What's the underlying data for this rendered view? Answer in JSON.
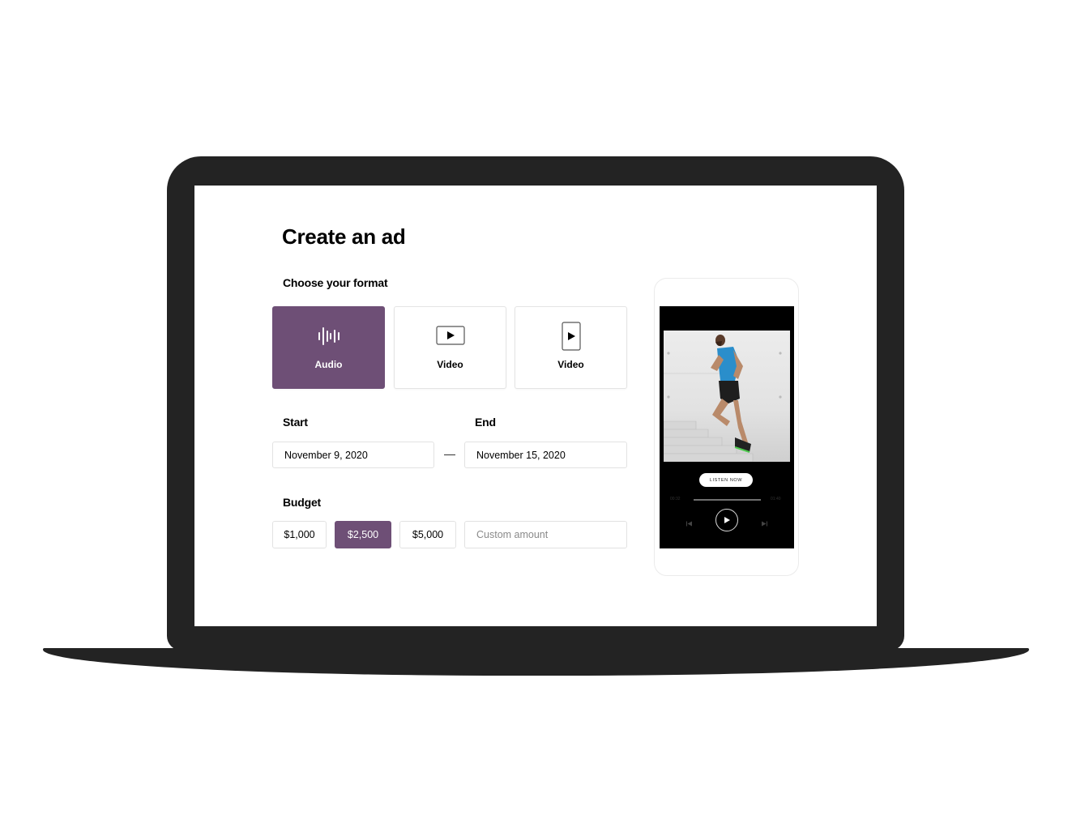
{
  "page": {
    "title": "Create an ad"
  },
  "format": {
    "label": "Choose your format",
    "options": [
      {
        "label": "Audio",
        "icon": "audio-waveform-icon",
        "selected": true
      },
      {
        "label": "Video",
        "icon": "landscape-video-icon",
        "selected": false
      },
      {
        "label": "Video",
        "icon": "portrait-video-icon",
        "selected": false
      }
    ]
  },
  "schedule": {
    "start_label": "Start",
    "start_value": "November 9, 2020",
    "separator": "—",
    "end_label": "End",
    "end_value": "November 15, 2020"
  },
  "budget": {
    "label": "Budget",
    "options": [
      {
        "label": "$1,000",
        "selected": false
      },
      {
        "label": "$2,500",
        "selected": true
      },
      {
        "label": "$5,000",
        "selected": false
      }
    ],
    "custom_placeholder": "Custom amount"
  },
  "preview": {
    "cta_label": "LISTEN NOW",
    "elapsed": "00:32",
    "duration": "01:40",
    "progress_fraction": 1.0
  },
  "colors": {
    "accent": "#6e4f76",
    "frame": "#232323"
  }
}
